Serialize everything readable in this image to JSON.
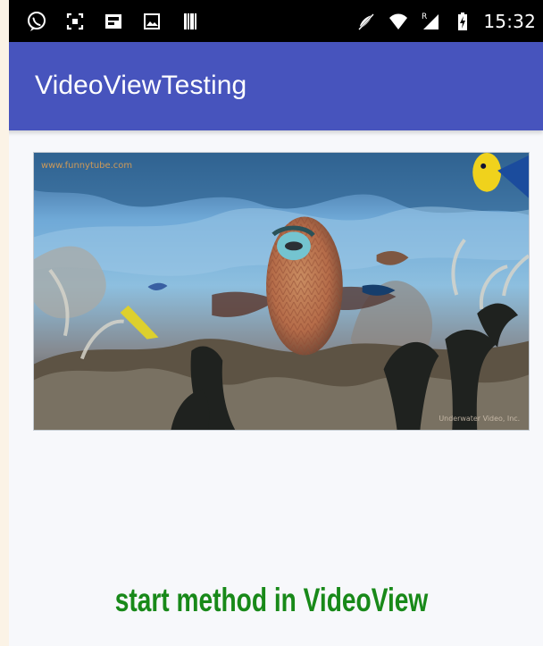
{
  "status_bar": {
    "time": "15:32",
    "left_icons": [
      "whatsapp-icon",
      "screenshot-icon",
      "image-icon",
      "photo-icon",
      "barcode-icon"
    ],
    "right_icons": [
      "mute-icon",
      "wifi-icon",
      "signal-icon",
      "battery-icon"
    ],
    "roaming_label": "R"
  },
  "app_bar": {
    "title": "VideoViewTesting",
    "background_color": "#4754bd"
  },
  "video": {
    "scene": "underwater reef with fish",
    "watermark_left": "www.funnytube.com",
    "watermark_right": "Underwater Video, Inc."
  },
  "caption": {
    "text": "start method in VideoView",
    "color": "#188919"
  }
}
